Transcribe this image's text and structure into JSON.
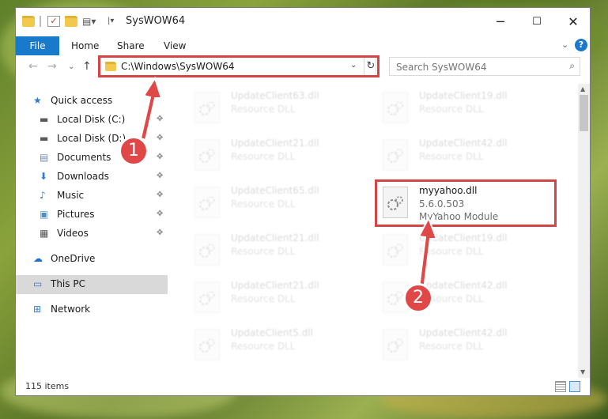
{
  "window": {
    "title": "SysWOW64"
  },
  "titlebar": {
    "minimize": "─",
    "maximize": "☐",
    "close": "✕"
  },
  "ribbon": {
    "tabs": [
      "File",
      "Home",
      "Share",
      "View"
    ],
    "collapse": "⌄",
    "help": "?"
  },
  "navbar": {
    "back": "←",
    "forward": "→",
    "recent": "⌄",
    "up": "↑",
    "address": "C:\\Windows\\SysWOW64",
    "address_dropdown": "⌄",
    "refresh": "↻",
    "search_placeholder": "Search SysWOW64"
  },
  "sidebar": {
    "items": [
      {
        "label": "Quick access",
        "icon": "star-icon",
        "glyph": "★",
        "color": "#2f7dd6",
        "pinned": false
      },
      {
        "label": "Local Disk (C:)",
        "icon": "drive-icon",
        "glyph": "▬",
        "color": "#5a5a5a",
        "pinned": true
      },
      {
        "label": "Local Disk (D:)",
        "icon": "drive-icon",
        "glyph": "▬",
        "color": "#5a5a5a",
        "pinned": true
      },
      {
        "label": "Documents",
        "icon": "documents-icon",
        "glyph": "▤",
        "color": "#6f8fb0",
        "pinned": true
      },
      {
        "label": "Downloads",
        "icon": "download-icon",
        "glyph": "⬇",
        "color": "#2f7dd6",
        "pinned": true
      },
      {
        "label": "Music",
        "icon": "music-icon",
        "glyph": "♪",
        "color": "#2f7dd6",
        "pinned": true
      },
      {
        "label": "Pictures",
        "icon": "pictures-icon",
        "glyph": "▣",
        "color": "#4a90c8",
        "pinned": true
      },
      {
        "label": "Videos",
        "icon": "video-icon",
        "glyph": "▦",
        "color": "#555555",
        "pinned": true
      },
      {
        "label": "OneDrive",
        "icon": "cloud-icon",
        "glyph": "☁",
        "color": "#1e6fd0",
        "pinned": false
      },
      {
        "label": "This PC",
        "icon": "computer-icon",
        "glyph": "▭",
        "color": "#2f7dd6",
        "pinned": false
      },
      {
        "label": "Network",
        "icon": "network-icon",
        "glyph": "⊞",
        "color": "#2f7dd6",
        "pinned": false
      }
    ],
    "pin_glyph": "✥"
  },
  "files": [
    {
      "name": "UpdateClient63.dll",
      "line2": "Resource DLL",
      "line3": ""
    },
    {
      "name": "UpdateClient19.dll",
      "line2": "Resource DLL",
      "line3": ""
    },
    {
      "name": "UpdateClient21.dll",
      "line2": "Resource DLL",
      "line3": ""
    },
    {
      "name": "UpdateClient42.dll",
      "line2": "Resource DLL",
      "line3": ""
    },
    {
      "name": "UpdateClient65.dll",
      "line2": "Resource DLL",
      "line3": ""
    },
    {
      "name": "myyahoo.dll",
      "line2": "5.6.0.503",
      "line3": "MyYahoo Module"
    },
    {
      "name": "UpdateClient21.dll",
      "line2": "Resource DLL",
      "line3": ""
    },
    {
      "name": "UpdateClient19.dll",
      "line2": "Resource DLL",
      "line3": ""
    },
    {
      "name": "UpdateClient21.dll",
      "line2": "Resource DLL",
      "line3": ""
    },
    {
      "name": "UpdateClient42.dll",
      "line2": "Resource DLL",
      "line3": ""
    },
    {
      "name": "UpdateClient5.dll",
      "line2": "Resource DLL",
      "line3": ""
    },
    {
      "name": "UpdateClient42.dll",
      "line2": "Resource DLL",
      "line3": ""
    }
  ],
  "status": {
    "items": "115 items"
  },
  "callouts": {
    "one": "1",
    "two": "2"
  },
  "colors": {
    "accent": "#1979ca",
    "highlight": "#d64545",
    "callout": "#e04848"
  }
}
